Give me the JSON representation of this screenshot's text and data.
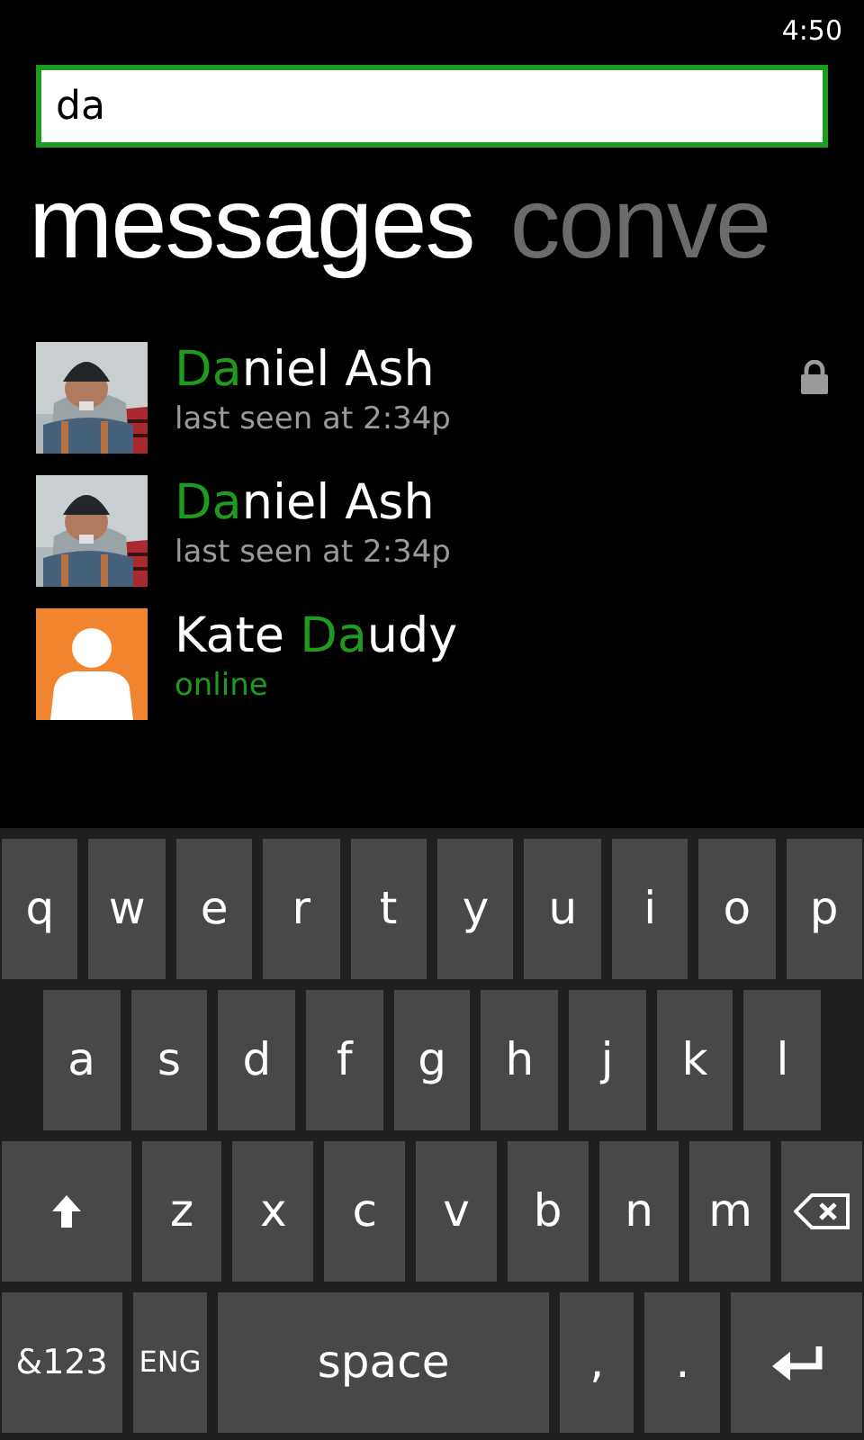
{
  "status_bar": {
    "time": "4:50"
  },
  "search": {
    "value": "da"
  },
  "pivot": [
    {
      "label": "messages",
      "selected": true
    },
    {
      "label": "conve",
      "selected": false
    }
  ],
  "contacts": [
    {
      "name_match": "Da",
      "name_end": "niel Ash",
      "status": "last seen at 2:34p",
      "online": false,
      "locked": true
    },
    {
      "name_match": "Da",
      "name_end": "niel Ash",
      "status": "last seen at 2:34p",
      "online": false,
      "locked": false
    },
    {
      "name_start": "Kate ",
      "name_match": "Da",
      "name_end": "udy",
      "status": "online",
      "online": true,
      "avatar": {
        "kind": "placeholder"
      },
      "locked": false
    }
  ],
  "keyboard": [
    [
      {
        "kind": "char",
        "label": "q"
      },
      {
        "kind": "char",
        "label": "w"
      },
      {
        "kind": "char",
        "label": "e"
      },
      {
        "kind": "char",
        "label": "r"
      },
      {
        "kind": "char",
        "label": "t"
      },
      {
        "kind": "char",
        "label": "y"
      },
      {
        "kind": "char",
        "label": "u"
      },
      {
        "kind": "char",
        "label": "i"
      },
      {
        "kind": "char",
        "label": "o"
      },
      {
        "kind": "char",
        "label": "p"
      }
    ],
    [
      {
        "kind": "char",
        "label": "a"
      },
      {
        "kind": "char",
        "label": "s"
      },
      {
        "kind": "char",
        "label": "d"
      },
      {
        "kind": "char",
        "label": "f"
      },
      {
        "kind": "char",
        "label": "g"
      },
      {
        "kind": "char",
        "label": "h"
      },
      {
        "kind": "char",
        "label": "j"
      },
      {
        "kind": "char",
        "label": "k"
      },
      {
        "kind": "char",
        "label": "l"
      }
    ],
    [
      {
        "kind": "shift"
      },
      {
        "kind": "char",
        "label": "z"
      },
      {
        "kind": "char",
        "label": "x"
      },
      {
        "kind": "char",
        "label": "c"
      },
      {
        "kind": "char",
        "label": "v"
      },
      {
        "kind": "char",
        "label": "b"
      },
      {
        "kind": "char",
        "label": "n"
      },
      {
        "kind": "char",
        "label": "m"
      },
      {
        "kind": "backspace"
      }
    ],
    [
      {
        "kind": "mode",
        "label": "&123"
      },
      {
        "kind": "lang",
        "label": "ENG"
      },
      {
        "kind": "space",
        "label": "space"
      },
      {
        "kind": "char",
        "label": ","
      },
      {
        "kind": "char",
        "label": "."
      },
      {
        "kind": "enter"
      }
    ]
  ]
}
